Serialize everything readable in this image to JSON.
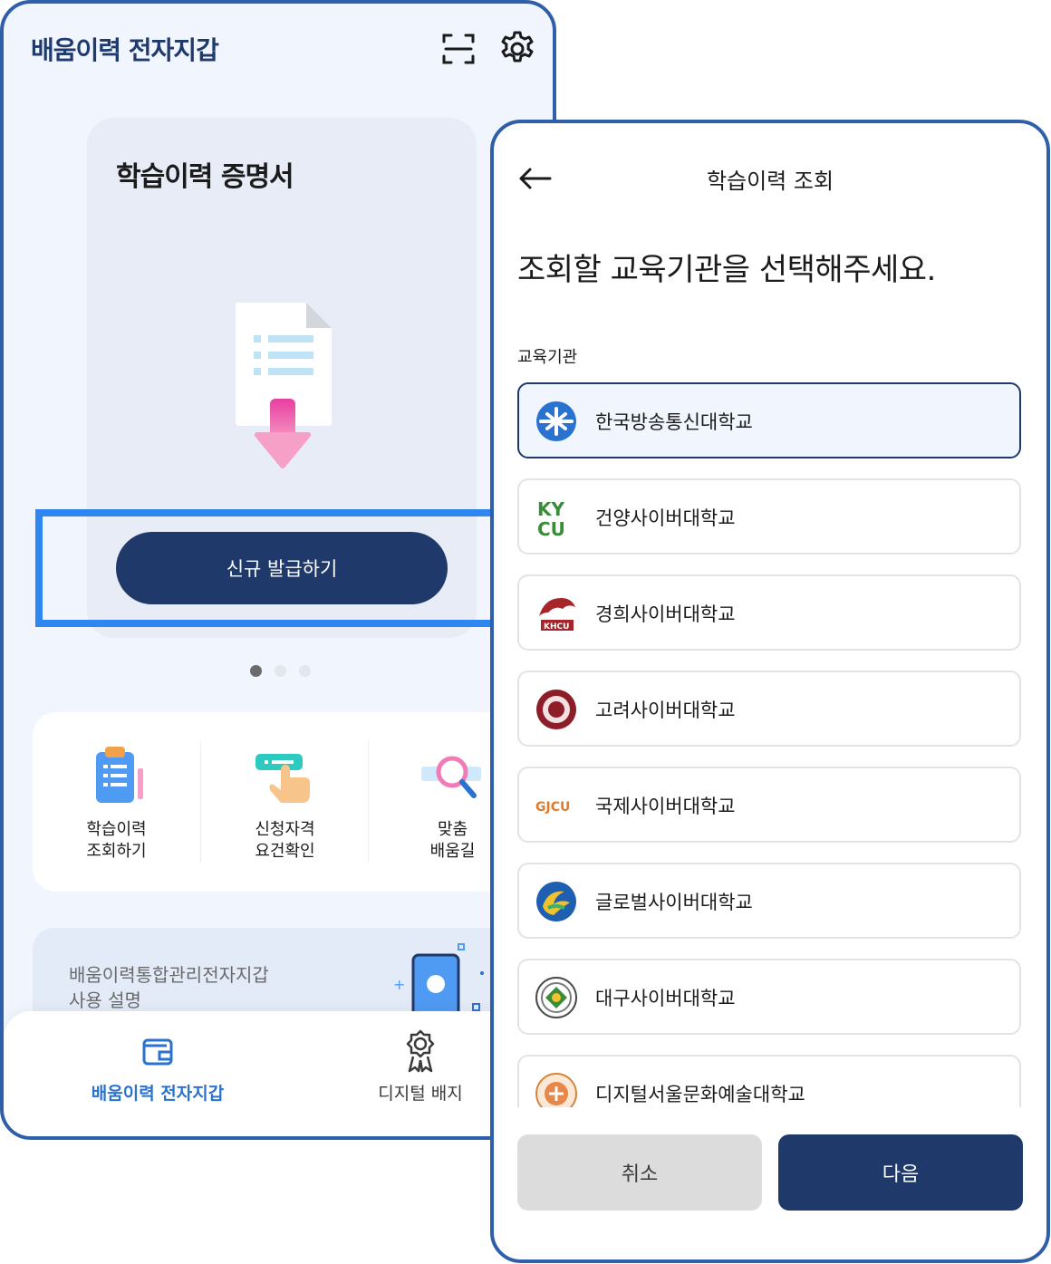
{
  "left_screen": {
    "app_title": "배움이력 전자지갑",
    "card": {
      "title": "학습이력 증명서",
      "issue_button": "신규 발급하기"
    },
    "carousel": {
      "active_index": 0,
      "count": 3
    },
    "menu": [
      {
        "label": "학습이력\n조회하기",
        "icon": "clipboard-icon"
      },
      {
        "label": "신청자격\n요건확인",
        "icon": "tap-hand-icon"
      },
      {
        "label": "맞춤\n배움길",
        "icon": "magnifier-icon"
      }
    ],
    "guide_banner": "배움이력통합관리전자지갑\n사용 설명",
    "bottom_nav": [
      {
        "label": "배움이력 전자지갑",
        "active": true,
        "icon": "wallet-icon"
      },
      {
        "label": "디지털 배지",
        "active": false,
        "icon": "badge-icon"
      }
    ]
  },
  "right_screen": {
    "title": "학습이력 조회",
    "question": "조회할 교육기관을 선택해주세요.",
    "field_label": "교육기관",
    "institutions": [
      {
        "name": "한국방송통신대학교",
        "selected": true
      },
      {
        "name": "건양사이버대학교",
        "selected": false
      },
      {
        "name": "경희사이버대학교",
        "selected": false
      },
      {
        "name": "고려사이버대학교",
        "selected": false
      },
      {
        "name": "국제사이버대학교",
        "selected": false
      },
      {
        "name": "글로벌사이버대학교",
        "selected": false
      },
      {
        "name": "대구사이버대학교",
        "selected": false
      },
      {
        "name": "디지털서울문화예술대학교",
        "selected": false
      }
    ],
    "logo_texts": {
      "kycu_top": "KY",
      "kycu_bottom": "CU",
      "khcu": "KHCU",
      "gjcu": "GJCU"
    },
    "cancel_button": "취소",
    "next_button": "다음"
  },
  "colors": {
    "navy": "#1f3a6a",
    "highlight_blue": "#2f86f0",
    "frame_blue": "#2f5fa8",
    "active_nav": "#2a72d0"
  }
}
